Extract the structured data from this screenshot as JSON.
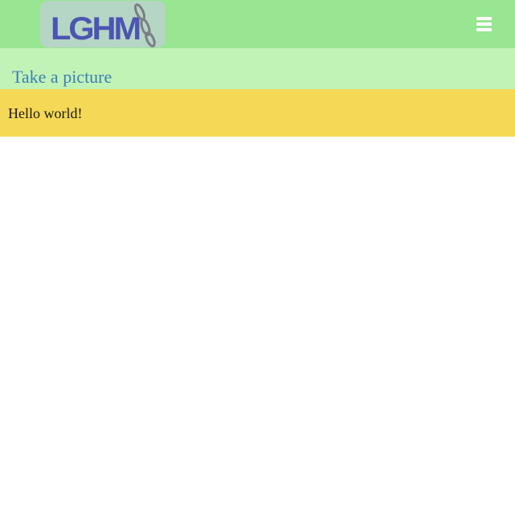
{
  "header": {
    "logo_text": "LGHM",
    "menu_icon": "hamburger-menu-icon"
  },
  "page": {
    "title": "Take a picture"
  },
  "banner": {
    "message": "Hello world!"
  },
  "colors": {
    "topbar": "#98e592",
    "subheader": "#c1f3b7",
    "banner": "#f5d855",
    "title_text": "#3c7fb6",
    "logo_bg": "#b5d6c4",
    "logo_letters": "#4b55b3"
  }
}
